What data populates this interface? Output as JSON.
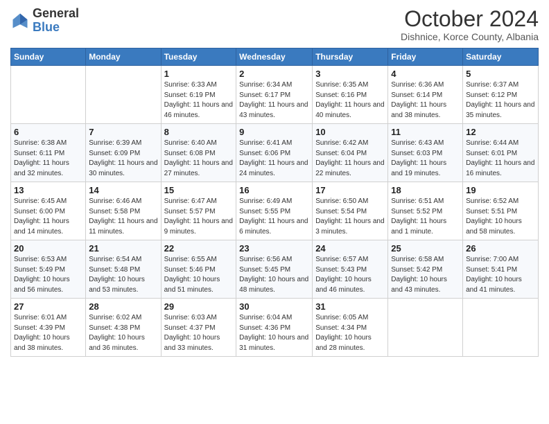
{
  "header": {
    "logo_general": "General",
    "logo_blue": "Blue",
    "month_title": "October 2024",
    "subtitle": "Dishnice, Korce County, Albania"
  },
  "days_of_week": [
    "Sunday",
    "Monday",
    "Tuesday",
    "Wednesday",
    "Thursday",
    "Friday",
    "Saturday"
  ],
  "weeks": [
    [
      {
        "day": "",
        "detail": ""
      },
      {
        "day": "",
        "detail": ""
      },
      {
        "day": "1",
        "detail": "Sunrise: 6:33 AM\nSunset: 6:19 PM\nDaylight: 11 hours and 46 minutes."
      },
      {
        "day": "2",
        "detail": "Sunrise: 6:34 AM\nSunset: 6:17 PM\nDaylight: 11 hours and 43 minutes."
      },
      {
        "day": "3",
        "detail": "Sunrise: 6:35 AM\nSunset: 6:16 PM\nDaylight: 11 hours and 40 minutes."
      },
      {
        "day": "4",
        "detail": "Sunrise: 6:36 AM\nSunset: 6:14 PM\nDaylight: 11 hours and 38 minutes."
      },
      {
        "day": "5",
        "detail": "Sunrise: 6:37 AM\nSunset: 6:12 PM\nDaylight: 11 hours and 35 minutes."
      }
    ],
    [
      {
        "day": "6",
        "detail": "Sunrise: 6:38 AM\nSunset: 6:11 PM\nDaylight: 11 hours and 32 minutes."
      },
      {
        "day": "7",
        "detail": "Sunrise: 6:39 AM\nSunset: 6:09 PM\nDaylight: 11 hours and 30 minutes."
      },
      {
        "day": "8",
        "detail": "Sunrise: 6:40 AM\nSunset: 6:08 PM\nDaylight: 11 hours and 27 minutes."
      },
      {
        "day": "9",
        "detail": "Sunrise: 6:41 AM\nSunset: 6:06 PM\nDaylight: 11 hours and 24 minutes."
      },
      {
        "day": "10",
        "detail": "Sunrise: 6:42 AM\nSunset: 6:04 PM\nDaylight: 11 hours and 22 minutes."
      },
      {
        "day": "11",
        "detail": "Sunrise: 6:43 AM\nSunset: 6:03 PM\nDaylight: 11 hours and 19 minutes."
      },
      {
        "day": "12",
        "detail": "Sunrise: 6:44 AM\nSunset: 6:01 PM\nDaylight: 11 hours and 16 minutes."
      }
    ],
    [
      {
        "day": "13",
        "detail": "Sunrise: 6:45 AM\nSunset: 6:00 PM\nDaylight: 11 hours and 14 minutes."
      },
      {
        "day": "14",
        "detail": "Sunrise: 6:46 AM\nSunset: 5:58 PM\nDaylight: 11 hours and 11 minutes."
      },
      {
        "day": "15",
        "detail": "Sunrise: 6:47 AM\nSunset: 5:57 PM\nDaylight: 11 hours and 9 minutes."
      },
      {
        "day": "16",
        "detail": "Sunrise: 6:49 AM\nSunset: 5:55 PM\nDaylight: 11 hours and 6 minutes."
      },
      {
        "day": "17",
        "detail": "Sunrise: 6:50 AM\nSunset: 5:54 PM\nDaylight: 11 hours and 3 minutes."
      },
      {
        "day": "18",
        "detail": "Sunrise: 6:51 AM\nSunset: 5:52 PM\nDaylight: 11 hours and 1 minute."
      },
      {
        "day": "19",
        "detail": "Sunrise: 6:52 AM\nSunset: 5:51 PM\nDaylight: 10 hours and 58 minutes."
      }
    ],
    [
      {
        "day": "20",
        "detail": "Sunrise: 6:53 AM\nSunset: 5:49 PM\nDaylight: 10 hours and 56 minutes."
      },
      {
        "day": "21",
        "detail": "Sunrise: 6:54 AM\nSunset: 5:48 PM\nDaylight: 10 hours and 53 minutes."
      },
      {
        "day": "22",
        "detail": "Sunrise: 6:55 AM\nSunset: 5:46 PM\nDaylight: 10 hours and 51 minutes."
      },
      {
        "day": "23",
        "detail": "Sunrise: 6:56 AM\nSunset: 5:45 PM\nDaylight: 10 hours and 48 minutes."
      },
      {
        "day": "24",
        "detail": "Sunrise: 6:57 AM\nSunset: 5:43 PM\nDaylight: 10 hours and 46 minutes."
      },
      {
        "day": "25",
        "detail": "Sunrise: 6:58 AM\nSunset: 5:42 PM\nDaylight: 10 hours and 43 minutes."
      },
      {
        "day": "26",
        "detail": "Sunrise: 7:00 AM\nSunset: 5:41 PM\nDaylight: 10 hours and 41 minutes."
      }
    ],
    [
      {
        "day": "27",
        "detail": "Sunrise: 6:01 AM\nSunset: 4:39 PM\nDaylight: 10 hours and 38 minutes."
      },
      {
        "day": "28",
        "detail": "Sunrise: 6:02 AM\nSunset: 4:38 PM\nDaylight: 10 hours and 36 minutes."
      },
      {
        "day": "29",
        "detail": "Sunrise: 6:03 AM\nSunset: 4:37 PM\nDaylight: 10 hours and 33 minutes."
      },
      {
        "day": "30",
        "detail": "Sunrise: 6:04 AM\nSunset: 4:36 PM\nDaylight: 10 hours and 31 minutes."
      },
      {
        "day": "31",
        "detail": "Sunrise: 6:05 AM\nSunset: 4:34 PM\nDaylight: 10 hours and 28 minutes."
      },
      {
        "day": "",
        "detail": ""
      },
      {
        "day": "",
        "detail": ""
      }
    ]
  ]
}
